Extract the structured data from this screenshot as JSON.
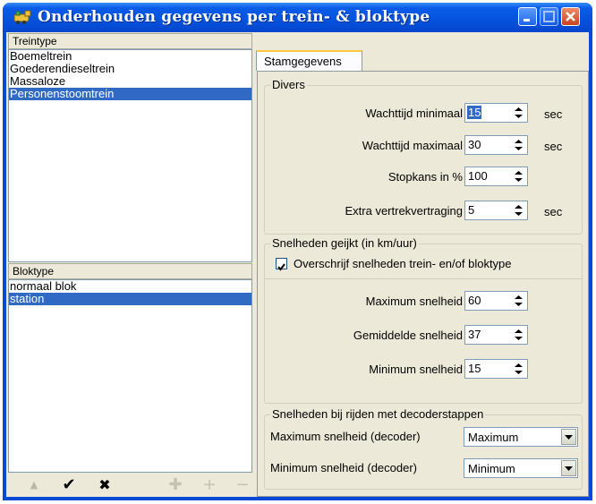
{
  "window": {
    "title": "Onderhouden gegevens per trein- & bloktype"
  },
  "train_types": {
    "header": "Treintype",
    "items": [
      "Boemeltrein",
      "Goederendieseltrein",
      "Massaloze",
      "Personenstoomtrein"
    ],
    "selected": "Personenstoomtrein"
  },
  "block_types": {
    "header": "Bloktype",
    "items": [
      "normaal blok",
      "station"
    ],
    "selected": "station"
  },
  "toolbar": {
    "up": "▲",
    "confirm": "✔",
    "cancel": "✖",
    "add_all": "✚",
    "add": "+",
    "remove": "−"
  },
  "tabs": [
    "Stamgegevens"
  ],
  "divers": {
    "title": "Divers",
    "wacht_min": {
      "label": "Wachttijd minimaal",
      "value": "15",
      "unit": "sec"
    },
    "wacht_max": {
      "label": "Wachttijd maximaal",
      "value": "30",
      "unit": "sec"
    },
    "stopkans": {
      "label": "Stopkans in %",
      "value": "100"
    },
    "extra": {
      "label": "Extra vertrekvertraging",
      "value": "5",
      "unit": "sec"
    }
  },
  "speeds": {
    "title": "Snelheden geijkt (in km/uur)",
    "override_label": "Overschrijf snelheden trein- en/of bloktype",
    "override_checked": true,
    "max": {
      "label": "Maximum snelheid",
      "value": "60"
    },
    "avg": {
      "label": "Gemiddelde snelheid",
      "value": "37"
    },
    "min": {
      "label": "Minimum snelheid",
      "value": "15"
    }
  },
  "decoder": {
    "title": "Snelheden bij rijden met decoderstappen",
    "max": {
      "label": "Maximum snelheid (decoder)",
      "value": "Maximum"
    },
    "min": {
      "label": "Minimum snelheid (decoder)",
      "value": "Minimum"
    }
  }
}
